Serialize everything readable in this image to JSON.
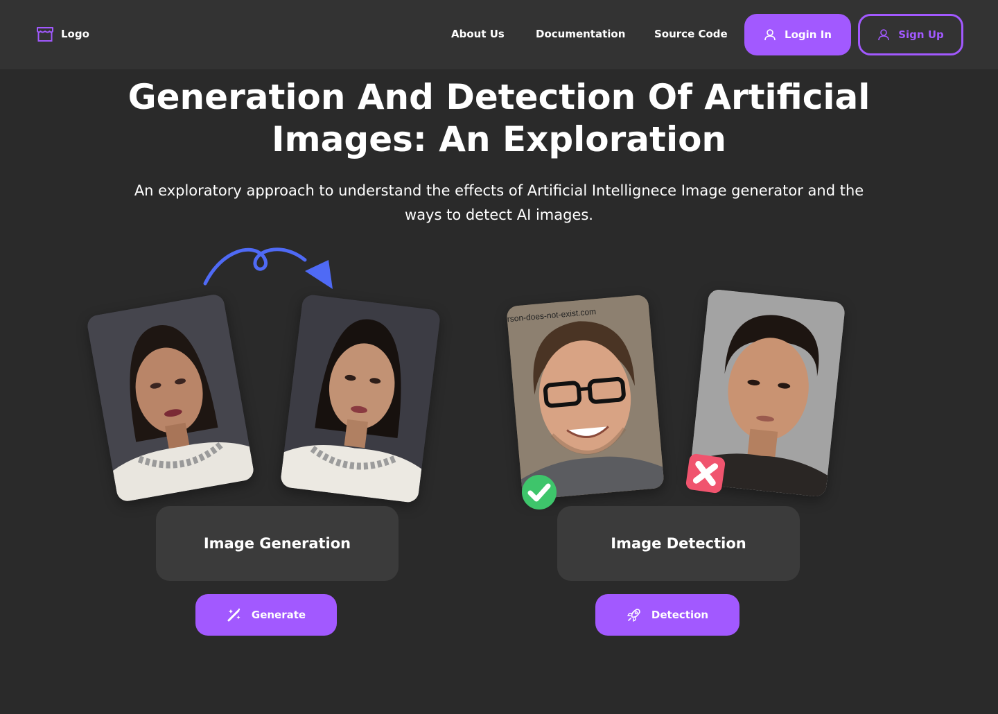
{
  "header": {
    "logo_label": "Logo",
    "nav": {
      "about": "About Us",
      "docs": "Documentation",
      "source": "Source Code"
    },
    "login_label": "Login In",
    "signup_label": "Sign Up"
  },
  "hero": {
    "title": "Generation And Detection Of Artificial Images: An Exploration",
    "subtitle": "An exploratory approach to understand the effects of Artificial Intellignece Image generator and the ways to detect AI images."
  },
  "generation": {
    "card_title": "Image Generation",
    "button_label": "Generate"
  },
  "detection": {
    "card_title": "Image Detection",
    "button_label": "Detection",
    "photo_watermark": "rson-does-not-exist.com"
  },
  "colors": {
    "accent": "#a259ff",
    "header_bg": "#333333",
    "page_bg": "#2a2a2a",
    "card_bg": "#3b3b3b",
    "arrow": "#4f6af5",
    "real_badge": "#3ec56b",
    "fake_badge": "#f0546e"
  },
  "icons": {
    "logo": "store-icon",
    "login": "user-icon",
    "signup": "user-icon",
    "generate": "magic-wand-icon",
    "detection": "rocket-icon",
    "real": "check-icon",
    "fake": "x-icon"
  }
}
